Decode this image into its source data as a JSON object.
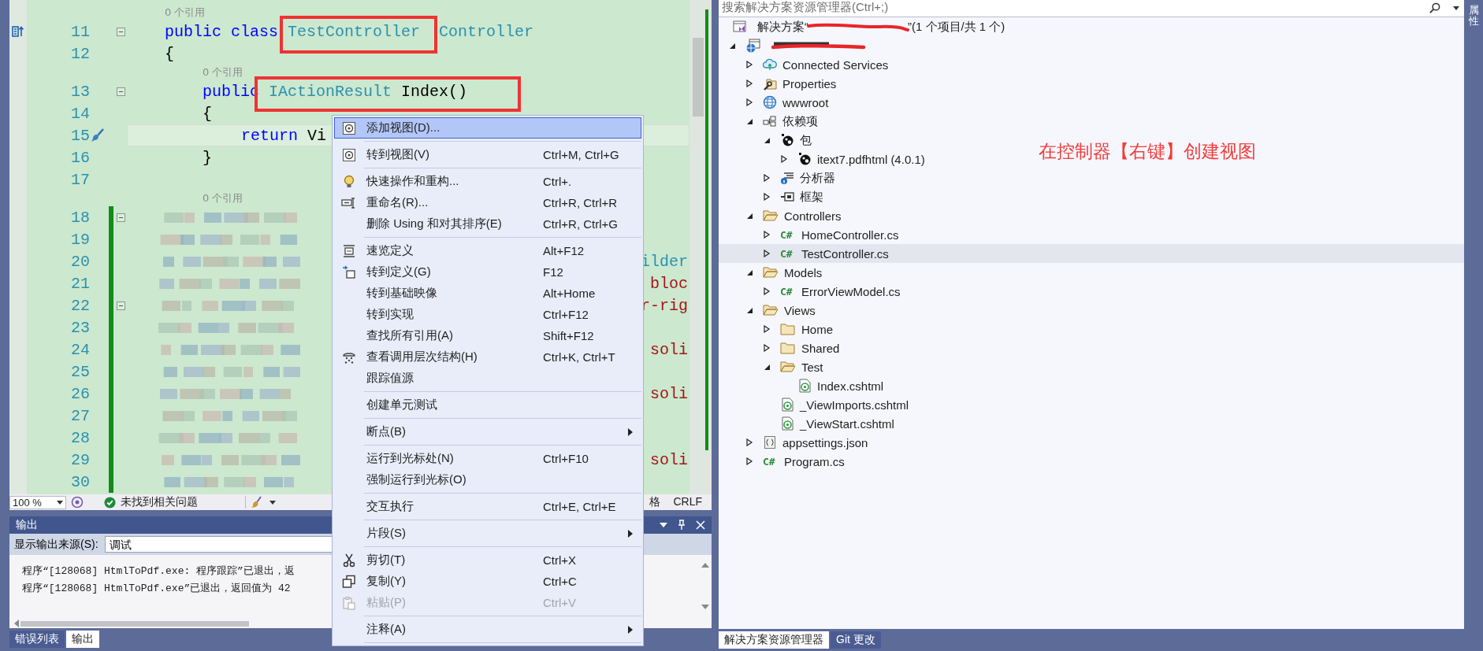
{
  "editor": {
    "lines": [
      {
        "number": "11",
        "lens": "0 个引用",
        "fold": true,
        "kind": "nav",
        "tokens": [
          {
            "text": "    public class ",
            "kind": "keyword"
          },
          {
            "text": "TestController",
            "kind": "type"
          },
          {
            "text": "  Controller",
            "kind": "type"
          }
        ]
      },
      {
        "number": "12",
        "tokens": [
          {
            "text": "    {",
            "kind": "plain"
          }
        ]
      },
      {
        "number": "13",
        "lens": "0 个引用",
        "fold": true,
        "tokens": [
          {
            "text": "        public",
            "kind": "keyword"
          },
          {
            "text": " IActionResult",
            "kind": "type"
          },
          {
            "text": " Index()",
            "kind": "plain"
          }
        ]
      },
      {
        "number": "14",
        "tokens": [
          {
            "text": "        {",
            "kind": "plain"
          }
        ]
      },
      {
        "number": "15",
        "current": true,
        "kind": "brush",
        "tokens": [
          {
            "text": "            return",
            "kind": "keyword"
          },
          {
            "text": " Vi",
            "kind": "plain"
          }
        ]
      },
      {
        "number": "16",
        "tokens": [
          {
            "text": "        }",
            "kind": "plain"
          }
        ]
      },
      {
        "number": "17"
      },
      {
        "number": "18",
        "lens": "0 个引用",
        "fold": true,
        "changed": true,
        "blurred": true
      },
      {
        "number": "19",
        "changed": true,
        "blurred": true
      },
      {
        "number": "20",
        "changed": true,
        "blurred": true,
        "tail": {
          "text": "ilder",
          "kind": "type"
        }
      },
      {
        "number": "21",
        "changed": true,
        "blurred": true,
        "tail": {
          "text": "bloc",
          "kind": "string"
        }
      },
      {
        "number": "22",
        "fold": true,
        "changed": true,
        "blurred": true,
        "tail": {
          "text": "r-rig",
          "kind": "string"
        }
      },
      {
        "number": "23",
        "changed": true,
        "blurred": true
      },
      {
        "number": "24",
        "changed": true,
        "blurred": true,
        "tail": {
          "text": "soli",
          "kind": "string"
        }
      },
      {
        "number": "25",
        "changed": true,
        "blurred": true
      },
      {
        "number": "26",
        "changed": true,
        "blurred": true,
        "tail": {
          "text": "soli",
          "kind": "string"
        }
      },
      {
        "number": "27",
        "changed": true,
        "blurred": true
      },
      {
        "number": "28",
        "changed": true,
        "blurred": true
      },
      {
        "number": "29",
        "changed": true,
        "blurred": true,
        "tail": {
          "text": "soli",
          "kind": "string"
        }
      },
      {
        "number": "30",
        "changed": true,
        "blurred": true
      }
    ]
  },
  "status_bar": {
    "zoom": "100 %",
    "issues": "未找到相关问题",
    "right": [
      "格",
      "CRLF"
    ]
  },
  "output": {
    "title": "输出",
    "source_label": "显示输出来源(S):",
    "source": "调试",
    "lines": [
      "程序“[128068] HtmlToPdf.exe: 程序跟踪”已退出，返",
      "程序“[128068] HtmlToPdf.exe”已退出，返回值为 42"
    ],
    "tabs": [
      {
        "label": "错误列表",
        "selected": false
      },
      {
        "label": "输出",
        "selected": true
      }
    ]
  },
  "context_menu": {
    "groups": [
      [
        {
          "label": "添加视图(D)...",
          "kind": "view",
          "selected": true,
          "disabled": false,
          "submenu": false
        }
      ],
      [
        {
          "label": "转到视图(V)",
          "shortcut": "Ctrl+M, Ctrl+G",
          "kind": "view",
          "selected": false,
          "disabled": false,
          "submenu": false
        }
      ],
      [
        {
          "label": "快速操作和重构...",
          "shortcut": "Ctrl+.",
          "kind": "bulb",
          "selected": false,
          "disabled": false,
          "submenu": false
        },
        {
          "label": "重命名(R)...",
          "shortcut": "Ctrl+R, Ctrl+R",
          "kind": "rename",
          "selected": false,
          "disabled": false,
          "submenu": false
        },
        {
          "label": "删除 Using 和对其排序(E)",
          "shortcut": "Ctrl+R, Ctrl+G",
          "kind": "plain",
          "selected": false,
          "disabled": false,
          "submenu": false
        }
      ],
      [
        {
          "label": "速览定义",
          "shortcut": "Alt+F12",
          "kind": "peek",
          "selected": false,
          "disabled": false,
          "submenu": false
        },
        {
          "label": "转到定义(G)",
          "shortcut": "F12",
          "kind": "goto",
          "selected": false,
          "disabled": false,
          "submenu": false
        },
        {
          "label": "转到基础映像",
          "shortcut": "Alt+Home",
          "kind": "plain",
          "selected": false,
          "disabled": false,
          "submenu": false
        },
        {
          "label": "转到实现",
          "shortcut": "Ctrl+F12",
          "kind": "plain",
          "selected": false,
          "disabled": false,
          "submenu": false
        },
        {
          "label": "查找所有引用(A)",
          "shortcut": "Shift+F12",
          "kind": "plain",
          "selected": false,
          "disabled": false,
          "submenu": false
        },
        {
          "label": "查看调用层次结构(H)",
          "shortcut": "Ctrl+K, Ctrl+T",
          "kind": "hierarchy",
          "selected": false,
          "disabled": false,
          "submenu": false
        },
        {
          "label": "跟踪值源",
          "kind": "plain",
          "selected": false,
          "disabled": false,
          "submenu": false
        }
      ],
      [
        {
          "label": "创建单元测试",
          "kind": "plain",
          "selected": false,
          "disabled": false,
          "submenu": false
        }
      ],
      [
        {
          "label": "断点(B)",
          "kind": "plain",
          "selected": false,
          "disabled": false,
          "submenu": true
        }
      ],
      [
        {
          "label": "运行到光标处(N)",
          "shortcut": "Ctrl+F10",
          "kind": "plain",
          "selected": false,
          "disabled": false,
          "submenu": false
        },
        {
          "label": "强制运行到光标(O)",
          "kind": "plain",
          "selected": false,
          "disabled": false,
          "submenu": false
        }
      ],
      [
        {
          "label": "交互执行",
          "shortcut": "Ctrl+E, Ctrl+E",
          "kind": "plain",
          "selected": false,
          "disabled": false,
          "submenu": false
        }
      ],
      [
        {
          "label": "片段(S)",
          "kind": "plain",
          "selected": false,
          "disabled": false,
          "submenu": true
        }
      ],
      [
        {
          "label": "剪切(T)",
          "shortcut": "Ctrl+X",
          "kind": "cut",
          "selected": false,
          "disabled": false,
          "submenu": false
        },
        {
          "label": "复制(Y)",
          "shortcut": "Ctrl+C",
          "kind": "copy",
          "selected": false,
          "disabled": false,
          "submenu": false
        },
        {
          "label": "粘贴(P)",
          "shortcut": "Ctrl+V",
          "kind": "paste",
          "selected": false,
          "disabled": true,
          "submenu": false
        }
      ],
      [
        {
          "label": "注释(A)",
          "kind": "plain",
          "selected": false,
          "disabled": false,
          "submenu": true
        }
      ]
    ]
  },
  "explorer": {
    "search": {
      "placeholder": "搜索解决方案资源管理器(Ctrl+;)"
    },
    "annotation": "在控制器【右键】创建视图",
    "solution": {
      "before": "解决方案“",
      "after": "”(1 个项目/共 1 个)"
    },
    "project": {
      "expanded": true,
      "children": [
        {
          "label": "Connected Services",
          "kind": "cloud",
          "expanded": false,
          "selected": false
        },
        {
          "label": "Properties",
          "kind": "properties",
          "expanded": false,
          "selected": false
        },
        {
          "label": "wwwroot",
          "kind": "globe",
          "expanded": false,
          "selected": false
        },
        {
          "label": "依赖项",
          "kind": "deps",
          "expanded": true,
          "selected": false,
          "children": [
            {
              "label": "包",
              "kind": "package",
              "expanded": true,
              "selected": false,
              "children": [
                {
                  "label": "itext7.pdfhtml (4.0.1)",
                  "kind": "package",
                  "expanded": false,
                  "selected": false
                }
              ]
            },
            {
              "label": "分析器",
              "kind": "analyzer",
              "expanded": false,
              "selected": false
            },
            {
              "label": "框架",
              "kind": "framework",
              "expanded": false,
              "selected": false
            }
          ]
        },
        {
          "label": "Controllers",
          "kind": "folder",
          "expanded": true,
          "selected": false,
          "children": [
            {
              "label": "HomeController.cs",
              "kind": "csharp",
              "badge": "C#",
              "expanded": false,
              "selected": false
            },
            {
              "label": "TestController.cs",
              "kind": "csharp",
              "badge": "C#",
              "expanded": false,
              "selected": true
            }
          ]
        },
        {
          "label": "Models",
          "kind": "folder",
          "expanded": true,
          "selected": false,
          "children": [
            {
              "label": "ErrorViewModel.cs",
              "kind": "csharp",
              "badge": "C#",
              "expanded": false,
              "selected": false
            }
          ]
        },
        {
          "label": "Views",
          "kind": "folder",
          "expanded": true,
          "selected": false,
          "children": [
            {
              "label": "Home",
              "kind": "folder",
              "expanded": false,
              "selected": false
            },
            {
              "label": "Shared",
              "kind": "folder",
              "expanded": false,
              "selected": false
            },
            {
              "label": "Test",
              "kind": "folder",
              "expanded": true,
              "selected": false,
              "children": [
                {
                  "label": "Index.cshtml",
                  "kind": "razor",
                  "selected": false
                }
              ]
            },
            {
              "label": "_ViewImports.cshtml",
              "kind": "razor",
              "selected": false
            },
            {
              "label": "_ViewStart.cshtml",
              "kind": "razor",
              "selected": false
            }
          ]
        },
        {
          "label": "appsettings.json",
          "kind": "json",
          "expanded": false,
          "selected": false
        },
        {
          "label": "Program.cs",
          "kind": "csharp",
          "badge": "C#",
          "expanded": false,
          "selected": false
        }
      ]
    },
    "tabs": [
      {
        "label": "解决方案资源管理器",
        "selected": true
      },
      {
        "label": "Git 更改",
        "selected": false
      }
    ]
  },
  "side_panel": {
    "label": "属性"
  }
}
